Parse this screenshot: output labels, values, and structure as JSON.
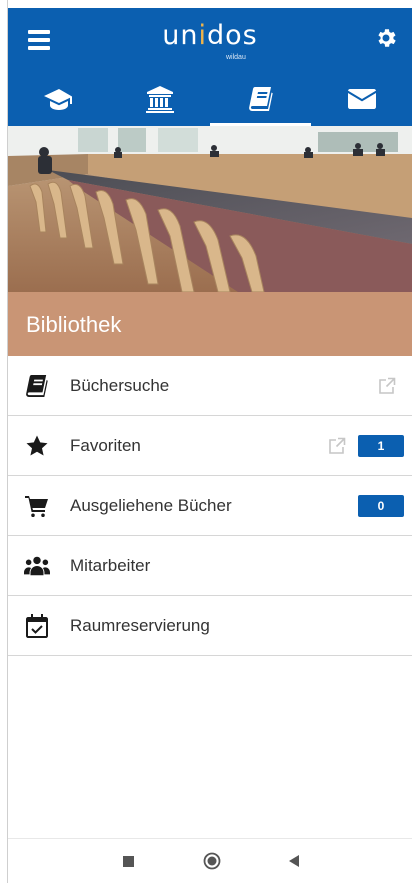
{
  "header": {
    "logo_prefix": "un",
    "logo_accent": "i",
    "logo_suffix": "dos",
    "logo_sub": "wildau"
  },
  "tabs": [
    {
      "icon": "graduation-cap-icon",
      "active": false
    },
    {
      "icon": "institution-icon",
      "active": false
    },
    {
      "icon": "book-icon",
      "active": true
    },
    {
      "icon": "envelope-icon",
      "active": false
    }
  ],
  "banner": {
    "title": "Bibliothek"
  },
  "menu": {
    "items": [
      {
        "label": "Büchersuche",
        "icon": "book-icon",
        "external": true
      },
      {
        "label": "Favoriten",
        "icon": "star-icon",
        "external": true,
        "badge": "1"
      },
      {
        "label": "Ausgeliehene Bücher",
        "icon": "cart-icon",
        "badge": "0"
      },
      {
        "label": "Mitarbeiter",
        "icon": "users-icon"
      },
      {
        "label": "Raumreservierung",
        "icon": "calendar-check-icon"
      }
    ]
  },
  "colors": {
    "primary": "#0b5fb0",
    "banner": "#c99575",
    "logo_accent": "#f0b44a"
  }
}
